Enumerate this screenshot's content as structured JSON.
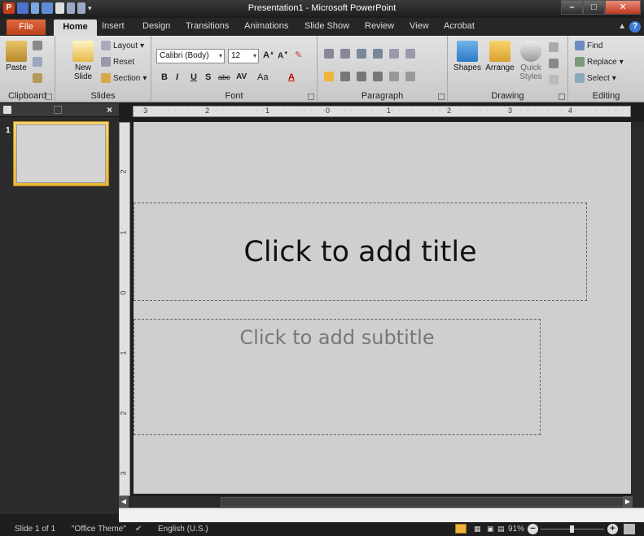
{
  "window": {
    "title": "Presentation1 - Microsoft PowerPoint",
    "logo_letter": "P"
  },
  "tabs": [
    "File",
    "Home",
    "Insert",
    "Design",
    "Transitions",
    "Animations",
    "Slide Show",
    "Review",
    "View",
    "Acrobat"
  ],
  "ribbon": {
    "clipboard": {
      "label": "Clipboard",
      "paste": "Paste"
    },
    "slides": {
      "label": "Slides",
      "new_slide_line1": "New",
      "new_slide_line2": "Slide",
      "layout": "Layout",
      "reset": "Reset",
      "section": "Section"
    },
    "font": {
      "label": "Font",
      "font_name": "Calibri (Body)",
      "font_size": "12",
      "bold": "B",
      "italic": "I",
      "underline": "U",
      "shadow": "S",
      "strike": "abc",
      "spacing": "AV",
      "case": "Aa",
      "color": "A"
    },
    "paragraph": {
      "label": "Paragraph"
    },
    "drawing": {
      "label": "Drawing",
      "shapes": "Shapes",
      "arrange": "Arrange",
      "quick_styles_line1": "Quick",
      "quick_styles_line2": "Styles"
    },
    "editing": {
      "label": "Editing",
      "find": "Find",
      "replace": "Replace",
      "select": "Select"
    }
  },
  "ruler": {
    "h_labels": [
      "3",
      "2",
      "1",
      "0",
      "1",
      "2",
      "3",
      "4"
    ],
    "v_labels": [
      "2",
      "1",
      "0",
      "1",
      "2",
      "3"
    ]
  },
  "slide": {
    "number": "1",
    "title_placeholder": "Click to add title",
    "subtitle_placeholder": "Click to add subtitle"
  },
  "status": {
    "slide_info": "Slide 1 of 1",
    "theme": "\"Office Theme\"",
    "language": "English (U.S.)",
    "zoom": "91%"
  },
  "colors": {
    "file_tab": "#c8481f",
    "accent": "#f0b43a"
  }
}
